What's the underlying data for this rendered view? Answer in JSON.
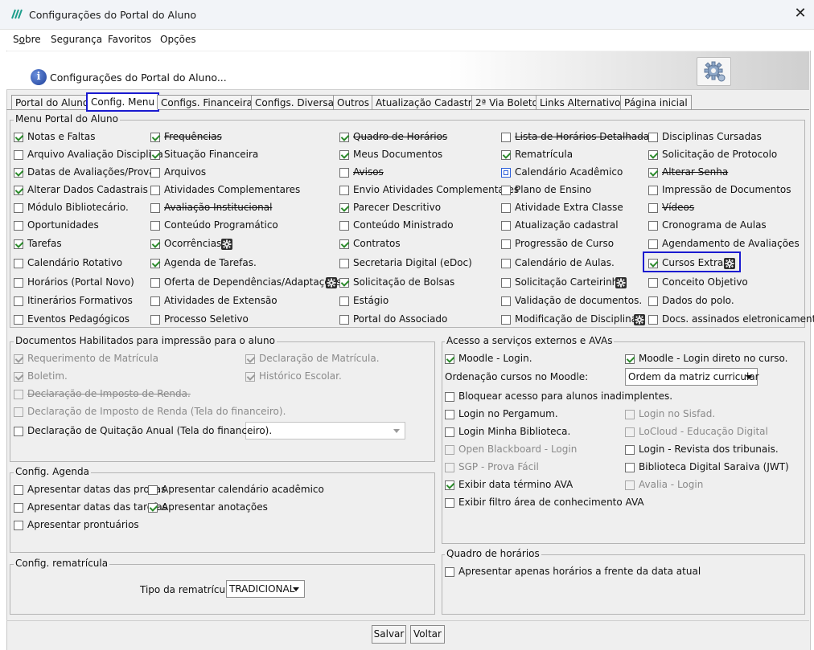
{
  "window": {
    "title": "Configurações do Portal do Aluno",
    "close_symbol": "✕"
  },
  "menu": [
    {
      "label": "Sobre",
      "mnemonic": "o"
    },
    {
      "label": "Segurança"
    },
    {
      "label": "Favoritos"
    },
    {
      "label": "Opções"
    }
  ],
  "banner": {
    "text": "Configurações do Portal do Aluno...",
    "info_icon": "info-icon",
    "settings_icon": "gear-icon"
  },
  "tabs": [
    {
      "label": "Portal do Aluno",
      "selected": false
    },
    {
      "label": "Config. Menu",
      "selected": true
    },
    {
      "label": "Configs. Financeiras",
      "selected": false
    },
    {
      "label": "Configs. Diversas",
      "selected": false
    },
    {
      "label": "Outros",
      "selected": false
    },
    {
      "label": "Atualização Cadastral",
      "selected": false
    },
    {
      "label": "2ª Via Boleto",
      "selected": false
    },
    {
      "label": "Links Alternativos",
      "selected": false
    },
    {
      "label": "Página inicial",
      "selected": false
    }
  ],
  "menu_group": {
    "title": "Menu Portal do Aluno",
    "columns": [
      [
        {
          "label": "Notas e Faltas",
          "checked": true
        },
        {
          "label": "Arquivo Avaliação Disciplina",
          "checked": false
        },
        {
          "label": "Datas de Avaliações/Provas",
          "checked": true
        },
        {
          "label": "Alterar Dados Cadastrais",
          "checked": true
        },
        {
          "label": "Módulo Bibliotecário.",
          "checked": false
        },
        {
          "label": "Oportunidades",
          "checked": false
        },
        {
          "label": "Tarefas",
          "checked": true
        },
        {
          "label": "Calendário Rotativo",
          "checked": false
        },
        {
          "label": "Horários (Portal Novo)",
          "checked": false
        },
        {
          "label": "Itinerários Formativos",
          "checked": false
        },
        {
          "label": "Eventos Pedagógicos",
          "checked": false
        }
      ],
      [
        {
          "label": "Frequências",
          "checked": true,
          "strike": true
        },
        {
          "label": "Situação Financeira",
          "checked": true
        },
        {
          "label": "Arquivos",
          "checked": false
        },
        {
          "label": "Atividades Complementares",
          "checked": false
        },
        {
          "label": "Avaliação Institucional",
          "checked": false,
          "strike": true
        },
        {
          "label": "Conteúdo Programático",
          "checked": false
        },
        {
          "label": "Ocorrências",
          "checked": true,
          "gear": true
        },
        {
          "label": "Agenda de Tarefas.",
          "checked": true
        },
        {
          "label": "Oferta de Dependências/Adaptações",
          "checked": false,
          "gear": true
        },
        {
          "label": "Atividades de Extensão",
          "checked": false
        },
        {
          "label": "Processo Seletivo",
          "checked": false
        }
      ],
      [
        {
          "label": "Quadro de Horários",
          "checked": true,
          "strike": true
        },
        {
          "label": "Meus Documentos",
          "checked": true
        },
        {
          "label": "Avisos",
          "checked": false,
          "strike": true
        },
        {
          "label": "Envio Atividades Complementares",
          "checked": false
        },
        {
          "label": "Parecer Descritivo",
          "checked": true
        },
        {
          "label": "Conteúdo Ministrado",
          "checked": false
        },
        {
          "label": "Contratos",
          "checked": true
        },
        {
          "label": "Secretaria Digital (eDoc)",
          "checked": false
        },
        {
          "label": "Solicitação de Bolsas",
          "checked": true
        },
        {
          "label": "Estágio",
          "checked": false
        },
        {
          "label": "Portal do Associado",
          "checked": false
        }
      ],
      [
        {
          "label": "Lista de Horários Detalhada",
          "checked": false,
          "strike": true
        },
        {
          "label": "Rematrícula",
          "checked": true
        },
        {
          "label": "Calendário Acadêmico",
          "checked": false,
          "square": true
        },
        {
          "label": "Plano de Ensino",
          "checked": false
        },
        {
          "label": "Atividade Extra Classe",
          "checked": false
        },
        {
          "label": "Atualização cadastral",
          "checked": false
        },
        {
          "label": "Progressão de Curso",
          "checked": false
        },
        {
          "label": "Calendário de Aulas.",
          "checked": false
        },
        {
          "label": "Solicitação Carteirinha",
          "checked": false,
          "gear": true
        },
        {
          "label": "Validação de documentos.",
          "checked": false
        },
        {
          "label": "Modificação de Disciplinas",
          "checked": false,
          "gear": true
        }
      ],
      [
        {
          "label": "Disciplinas Cursadas",
          "checked": false
        },
        {
          "label": "Solicitação de Protocolo",
          "checked": true
        },
        {
          "label": "Alterar Senha",
          "checked": true,
          "strike": true
        },
        {
          "label": "Impressão de Documentos",
          "checked": false
        },
        {
          "label": "Vídeos",
          "checked": false,
          "strike": true
        },
        {
          "label": "Cronograma de Aulas",
          "checked": false
        },
        {
          "label": "Agendamento de Avaliações",
          "checked": false
        },
        {
          "label": "Cursos Extras",
          "checked": true,
          "gear": true,
          "highlight": true
        },
        {
          "label": "Conceito Objetivo",
          "checked": false
        },
        {
          "label": "Dados do polo.",
          "checked": false
        },
        {
          "label": "Docs. assinados eletronicamente.",
          "checked": false
        }
      ]
    ]
  },
  "docs_group": {
    "title": "Documentos Habilitados para impressão para o aluno",
    "items": [
      {
        "label": "Requerimento de Matrícula",
        "checked": true,
        "disabled": true
      },
      {
        "label": "Declaração de Matrícula.",
        "checked": true,
        "disabled": true
      },
      {
        "label": "Boletim.",
        "checked": true,
        "disabled": true
      },
      {
        "label": "Histórico Escolar.",
        "checked": true,
        "disabled": true
      },
      {
        "label": "Declaração de Imposto de Renda.",
        "checked": false,
        "disabled": true,
        "strike": true
      },
      {
        "label": "Declaração de Imposto de Renda (Tela do financeiro).",
        "checked": false,
        "disabled": true
      },
      {
        "label": "Declaração de Quitação Anual (Tela do financeiro).",
        "checked": false,
        "disabled": false
      }
    ],
    "quitacao_combo_value": ""
  },
  "agenda_group": {
    "title": "Config. Agenda",
    "items": [
      {
        "label": "Apresentar datas das provas",
        "checked": false
      },
      {
        "label": "Apresentar calendário acadêmico",
        "checked": false
      },
      {
        "label": "Apresentar datas das tarefas",
        "checked": false
      },
      {
        "label": "Apresentar anotações",
        "checked": true
      },
      {
        "label": "Apresentar prontuários",
        "checked": false
      }
    ]
  },
  "rematricula_group": {
    "title": "Config. rematrícula",
    "tipo_label": "Tipo da rematrícula:",
    "tipo_value": "TRADICIONAL"
  },
  "external_group": {
    "title": "Acesso a serviços externos e AVAs",
    "moodle_login": {
      "label": "Moodle - Login.",
      "checked": true
    },
    "moodle_direct": {
      "label": "Moodle - Login direto no curso.",
      "checked": true
    },
    "ordering_label": "Ordenação cursos no Moodle:",
    "ordering_value": "Ordem da matriz curricular",
    "bloquear": {
      "label": "Bloquear acesso para alunos inadimplentes.",
      "checked": false
    },
    "left_items": [
      {
        "label": "Login no Pergamum.",
        "checked": false,
        "disabled": false
      },
      {
        "label": "Login Minha Biblioteca.",
        "checked": false,
        "disabled": false
      },
      {
        "label": "Open Blackboard - Login",
        "checked": false,
        "disabled": true
      },
      {
        "label": "SGP - Prova Fácil",
        "checked": false,
        "disabled": true
      },
      {
        "label": "Exibir data término AVA",
        "checked": true,
        "disabled": false
      },
      {
        "label": "Exibir filtro área de conhecimento AVA",
        "checked": false,
        "disabled": false
      }
    ],
    "right_items": [
      {
        "label": "Login no Sisfad.",
        "checked": false,
        "disabled": true
      },
      {
        "label": "LoCloud - Educação Digital",
        "checked": false,
        "disabled": true
      },
      {
        "label": "Login - Revista dos tribunais.",
        "checked": false,
        "disabled": false
      },
      {
        "label": "Biblioteca Digital Saraiva (JWT)",
        "checked": false,
        "disabled": false
      },
      {
        "label": "Avalia - Login",
        "checked": false,
        "disabled": true
      }
    ]
  },
  "schedule_group": {
    "title": "Quadro de horários",
    "item": {
      "label": "Apresentar apenas horários a frente da data atual",
      "checked": false
    }
  },
  "buttons": {
    "save": "Salvar",
    "back": "Voltar"
  },
  "colors": {
    "accent_highlight": "#1a1ad0",
    "check_green": "#2b8a2b"
  }
}
